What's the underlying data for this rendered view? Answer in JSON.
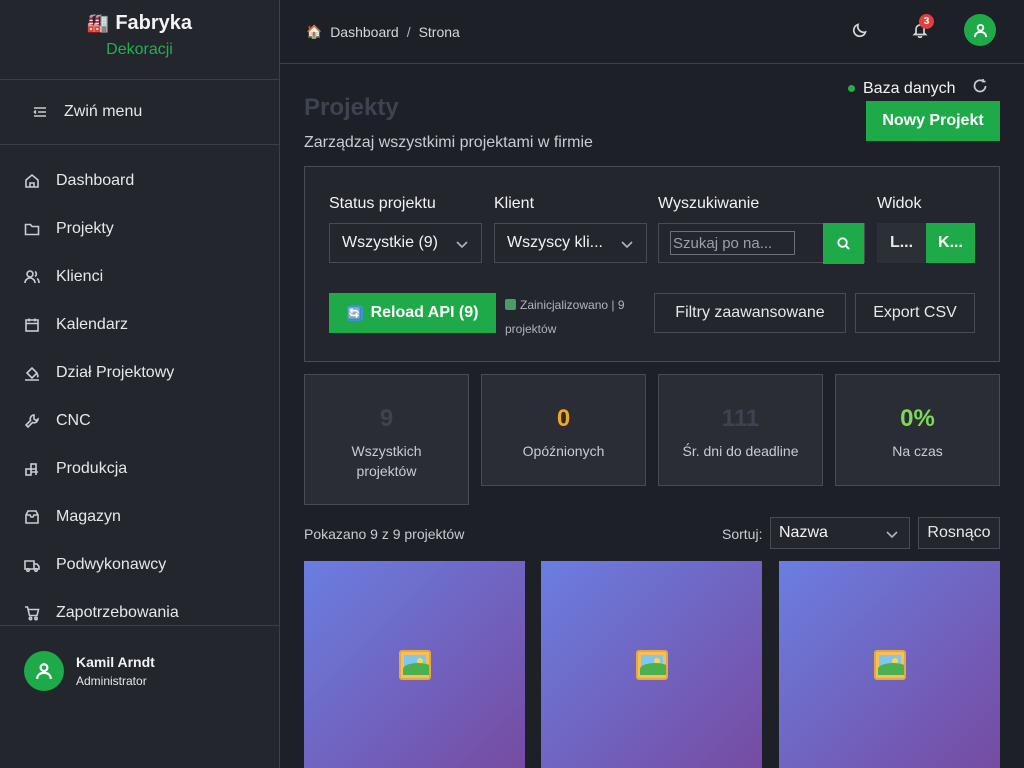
{
  "brand": {
    "title": "Fabryka",
    "subtitle": "Dekoracji",
    "icon": "factory-icon"
  },
  "sidebar": {
    "collapse_label": "Zwiń menu",
    "items": [
      {
        "label": "Dashboard",
        "icon": "home-icon"
      },
      {
        "label": "Projekty",
        "icon": "folder-icon"
      },
      {
        "label": "Klienci",
        "icon": "users-icon"
      },
      {
        "label": "Kalendarz",
        "icon": "calendar-icon"
      },
      {
        "label": "Dział Projektowy",
        "icon": "paint-bucket-icon"
      },
      {
        "label": "CNC",
        "icon": "wrench-icon"
      },
      {
        "label": "Produkcja",
        "icon": "production-icon"
      },
      {
        "label": "Magazyn",
        "icon": "archive-icon"
      },
      {
        "label": "Podwykonawcy",
        "icon": "truck-icon"
      },
      {
        "label": "Zapotrzebowania",
        "icon": "cart-icon"
      }
    ],
    "user": {
      "name": "Kamil Arndt",
      "role": "Administrator"
    }
  },
  "topbar": {
    "breadcrumb": [
      "Dashboard",
      "Strona"
    ],
    "breadcrumb_sep": "/",
    "notification_count": "3"
  },
  "header": {
    "title": "Projekty",
    "subtitle": "Zarządzaj wszystkimi projektami w firmie",
    "db_status": "Baza danych",
    "new_button": "Nowy Projekt"
  },
  "filters": {
    "status_label": "Status projektu",
    "status_value": "Wszystkie (9)",
    "client_label": "Klient",
    "client_value": "Wszyscy kli...",
    "search_label": "Wyszukiwanie",
    "search_placeholder": "Szukaj po na...",
    "view_label": "Widok",
    "view_options": [
      "L...",
      "K..."
    ],
    "reload_button": "Reload API (9)",
    "init_status": "Zainicjalizowano | 9 projektów",
    "advanced_button": "Filtry zaawansowane",
    "export_button": "Export CSV"
  },
  "stats": [
    {
      "value": "9",
      "label": "Wszystkich projektów",
      "color": "#3e4350"
    },
    {
      "value": "0",
      "label": "Opóźnionych",
      "color": "#f5a524"
    },
    {
      "value": "111",
      "label": "Śr. dni do deadline",
      "color": "#3e4350"
    },
    {
      "value": "0%",
      "label": "Na czas",
      "color": "#7ed957"
    }
  ],
  "list": {
    "count_text": "Pokazano 9 z 9 projektów",
    "sort_label": "Sortuj:",
    "sort_value": "Nazwa",
    "order_button": "Rosnąco"
  },
  "colors": {
    "accent": "#1faa4a",
    "badge": "#e53e3e",
    "card_gradient_start": "#6a7ee0",
    "card_gradient_end": "#764ba2"
  }
}
